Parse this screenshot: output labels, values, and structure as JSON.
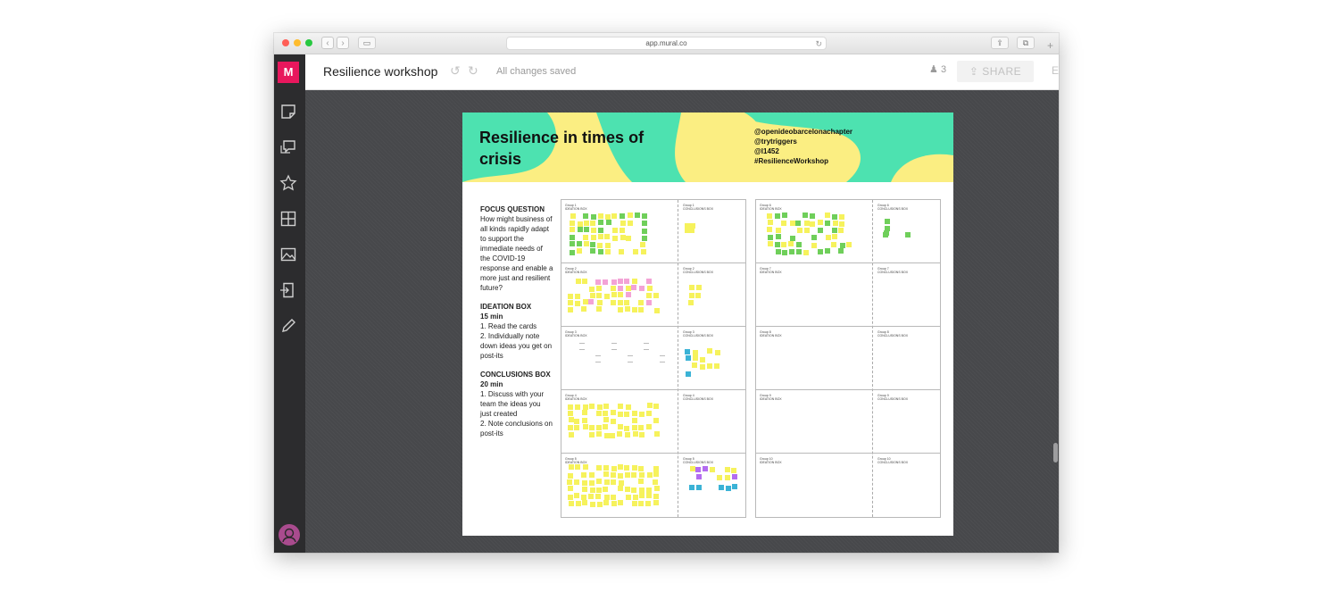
{
  "browser": {
    "url": "app.mural.co",
    "traffic_lights": [
      "#ff5f57",
      "#febc2e",
      "#28c840"
    ]
  },
  "app": {
    "logo_letter": "M",
    "board_title": "Resilience workshop",
    "save_status": "All changes saved",
    "user_count": "3",
    "share_label": "SHARE",
    "more_label": "E",
    "sidebar_tools": [
      "sticky-note-icon",
      "comment-icon",
      "star-icon",
      "grid-icon",
      "image-icon",
      "import-icon",
      "pen-icon"
    ],
    "colors": {
      "brand": "#e8175d",
      "sidebar": "#2c2c2e",
      "canvas": "#4a4b4e"
    }
  },
  "board": {
    "title": "Resilience in times of crisis",
    "handles": [
      "@openideobarcelonachapter",
      "@trytriggers",
      "@l1452",
      "#ResilienceWorkshop"
    ],
    "banner_colors": {
      "yellow": "#fbee82",
      "green": "#4de2b0"
    },
    "instructions": {
      "focus_title": "FOCUS QUESTION",
      "focus_text": "How might business of all kinds rapidly adapt to support the immediate needs of the COVID-19 response and enable a more just and resilient future?",
      "ideation_title": "IDEATION BOX",
      "ideation_time": "15 min",
      "ideation_steps": [
        "1. Read the cards",
        "2. Individually note down ideas you get on post-its"
      ],
      "conclusions_title": "CONCLUSIONS BOX",
      "conclusions_time": "20 min",
      "conclusions_steps": [
        "1. Discuss with your team the ideas you just created",
        "2. Note conclusions on post-its"
      ]
    },
    "tables": [
      {
        "groups": [
          {
            "ideation": "Group 1\nIDEATION BOX",
            "conclusions": "Group 1\nCONCLUSIONS BOX"
          },
          {
            "ideation": "Group 2\nIDEATION BOX",
            "conclusions": "Group 2\nCONCLUSIONS BOX"
          },
          {
            "ideation": "Group 3\nIDEATION BOX",
            "conclusions": "Group 3\nCONCLUSIONS BOX"
          },
          {
            "ideation": "Group 4\nIDEATION BOX",
            "conclusions": "Group 4\nCONCLUSIONS BOX"
          },
          {
            "ideation": "Group 5\nIDEATION BOX",
            "conclusions": "Group 5\nCONCLUSIONS BOX"
          }
        ]
      },
      {
        "groups": [
          {
            "ideation": "Group 6\nIDEATION BOX",
            "conclusions": "Group 6\nCONCLUSIONS BOX"
          },
          {
            "ideation": "Group 7\nIDEATION BOX",
            "conclusions": "Group 7\nCONCLUSIONS BOX"
          },
          {
            "ideation": "Group 8\nIDEATION BOX",
            "conclusions": "Group 8\nCONCLUSIONS BOX"
          },
          {
            "ideation": "Group 9\nIDEATION BOX",
            "conclusions": "Group 9\nCONCLUSIONS BOX"
          },
          {
            "ideation": "Group 10\nIDEATION BOX",
            "conclusions": "Group 10\nCONCLUSIONS BOX"
          }
        ]
      }
    ],
    "note_colors": {
      "yellow": "#f6f25c",
      "pink": "#f3a3d6",
      "green": "#6fcf5a",
      "blue": "#3bb3d6",
      "purple": "#b36cf0"
    }
  },
  "collaborators": [
    {
      "icon": "user-avatar-icon",
      "color": "#a94b8e"
    },
    {
      "icon": "user-avatar-icon",
      "color": "#2d3b46"
    }
  ]
}
